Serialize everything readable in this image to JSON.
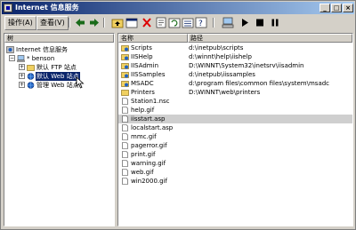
{
  "window": {
    "title": "Internet 信息服务"
  },
  "menu": {
    "action": "操作(A)",
    "view": "查看(V)"
  },
  "toolbar": {
    "icons": [
      "back-arrow-icon",
      "forward-arrow-icon",
      "up-folder-icon",
      "properties-icon",
      "delete-icon",
      "properties-sheet-icon",
      "refresh-icon",
      "export-list-icon",
      "help-icon",
      "computer-icon",
      "play-icon",
      "stop-icon",
      "pause-icon"
    ]
  },
  "tree": {
    "header": "树",
    "root": "Internet 信息服务",
    "server": "* benson",
    "children": [
      "默认 FTP 站点",
      "默认 Web 站点",
      "管理 Web 站点"
    ],
    "selected_index": 1
  },
  "list": {
    "columns": {
      "name": "名称",
      "path": "路径"
    },
    "rows": [
      {
        "name": "Scripts",
        "path": "d:\\inetpub\\scripts",
        "type": "vdir"
      },
      {
        "name": "IISHelp",
        "path": "d:\\winnt\\help\\iishelp",
        "type": "vdir"
      },
      {
        "name": "IISAdmin",
        "path": "D:\\WINNT\\System32\\inetsrv\\iisadmin",
        "type": "vdir"
      },
      {
        "name": "IISSamples",
        "path": "d:\\inetpub\\iissamples",
        "type": "vdir"
      },
      {
        "name": "MSADC",
        "path": "d:\\program files\\common files\\system\\msadc",
        "type": "vdir"
      },
      {
        "name": "Printers",
        "path": "D:\\WINNT\\web\\printers",
        "type": "folder"
      },
      {
        "name": "Station1.nsc",
        "path": "",
        "type": "file"
      },
      {
        "name": "help.gif",
        "path": "",
        "type": "file"
      },
      {
        "name": "iisstart.asp",
        "path": "",
        "type": "file"
      },
      {
        "name": "localstart.asp",
        "path": "",
        "type": "file"
      },
      {
        "name": "mmc.gif",
        "path": "",
        "type": "file"
      },
      {
        "name": "pagerror.gif",
        "path": "",
        "type": "file"
      },
      {
        "name": "print.gif",
        "path": "",
        "type": "file"
      },
      {
        "name": "warning.gif",
        "path": "",
        "type": "file"
      },
      {
        "name": "web.gif",
        "path": "",
        "type": "file"
      },
      {
        "name": "win2000.gif",
        "path": "",
        "type": "file"
      }
    ],
    "highlighted_index": 8
  },
  "colors": {
    "titlebar_start": "#0a246a",
    "titlebar_end": "#a6caf0",
    "selection": "#0a246a",
    "row_highlight": "#cfcfcf"
  }
}
